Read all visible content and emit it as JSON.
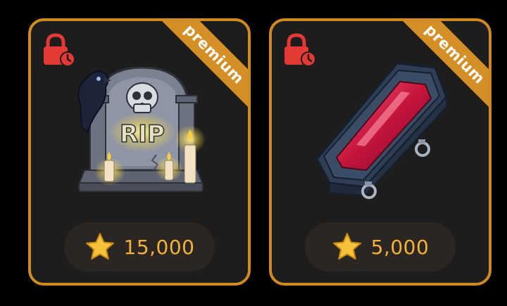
{
  "items": [
    {
      "name_icon": "tombstone-icon",
      "badge": "premium",
      "price": "15,000",
      "locked": true
    },
    {
      "name_icon": "coffin-icon",
      "badge": "premium",
      "price": "5,000",
      "locked": true
    }
  ],
  "colors": {
    "card_border": "#d08a24",
    "card_bg": "#1d1d1d",
    "ribbon": "#d49026",
    "lock": "#e53935",
    "price_text": "#f2b23a",
    "price_pill": "#2b2621"
  }
}
